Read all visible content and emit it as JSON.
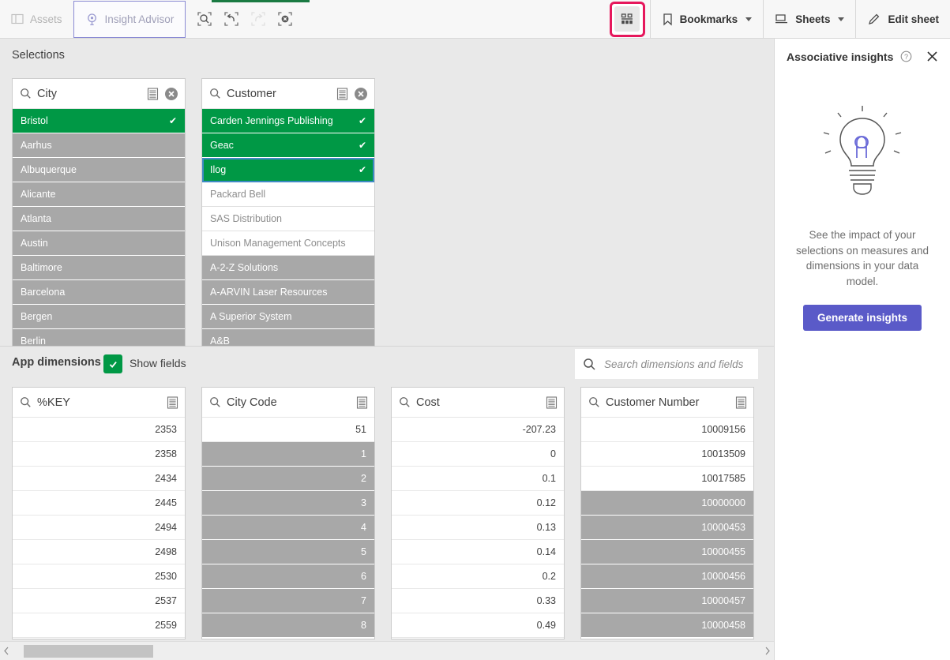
{
  "toolbar": {
    "assets_label": "Assets",
    "insight_advisor_label": "Insight Advisor",
    "selection_search_icon": "selection-search-icon",
    "step_back_icon": "step-back-icon",
    "step_forward_icon": "step-forward-icon",
    "clear_all_icon": "clear-all-selections-icon",
    "selections_tool_icon": "selections-tool-icon",
    "bookmarks_label": "Bookmarks",
    "sheets_label": "Sheets",
    "edit_sheet_label": "Edit sheet",
    "highlight_color": "#e6175c",
    "accent_green": "#1a7a42"
  },
  "selections": {
    "title": "Selections",
    "listboxes": [
      {
        "field": "City",
        "has_clear": true,
        "values": [
          {
            "text": "Bristol",
            "state": "selected",
            "check": true
          },
          {
            "text": "Aarhus",
            "state": "excluded"
          },
          {
            "text": "Albuquerque",
            "state": "excluded"
          },
          {
            "text": "Alicante",
            "state": "excluded"
          },
          {
            "text": "Atlanta",
            "state": "excluded"
          },
          {
            "text": "Austin",
            "state": "excluded"
          },
          {
            "text": "Baltimore",
            "state": "excluded"
          },
          {
            "text": "Barcelona",
            "state": "excluded"
          },
          {
            "text": "Bergen",
            "state": "excluded"
          },
          {
            "text": "Berlin",
            "state": "excluded"
          }
        ]
      },
      {
        "field": "Customer",
        "has_clear": true,
        "values": [
          {
            "text": "Carden Jennings Publishing",
            "state": "selected",
            "check": true
          },
          {
            "text": "Geac",
            "state": "selected",
            "check": true
          },
          {
            "text": "Ilog",
            "state": "selected",
            "check": true,
            "focus": true
          },
          {
            "text": "Packard Bell",
            "state": "alt"
          },
          {
            "text": "SAS Distribution",
            "state": "alt"
          },
          {
            "text": "Unison Management Concepts",
            "state": "alt"
          },
          {
            "text": "A-2-Z Solutions",
            "state": "excluded"
          },
          {
            "text": "A-ARVIN Laser Resources",
            "state": "excluded"
          },
          {
            "text": "A Superior System",
            "state": "excluded"
          },
          {
            "text": "A&B",
            "state": "excluded"
          }
        ]
      }
    ]
  },
  "app_dimensions": {
    "title": "App dimensions",
    "show_fields_label": "Show fields",
    "show_fields_checked": true,
    "search_placeholder": "Search dimensions and fields",
    "search_value": "",
    "fields": [
      {
        "field": "%KEY",
        "values": [
          {
            "text": "2353",
            "state": "avail"
          },
          {
            "text": "2358",
            "state": "avail"
          },
          {
            "text": "2434",
            "state": "avail"
          },
          {
            "text": "2445",
            "state": "avail"
          },
          {
            "text": "2494",
            "state": "avail"
          },
          {
            "text": "2498",
            "state": "avail"
          },
          {
            "text": "2530",
            "state": "avail"
          },
          {
            "text": "2537",
            "state": "avail"
          },
          {
            "text": "2559",
            "state": "avail"
          }
        ]
      },
      {
        "field": "City Code",
        "values": [
          {
            "text": "51",
            "state": "avail"
          },
          {
            "text": "1",
            "state": "excluded"
          },
          {
            "text": "2",
            "state": "excluded"
          },
          {
            "text": "3",
            "state": "excluded"
          },
          {
            "text": "4",
            "state": "excluded"
          },
          {
            "text": "5",
            "state": "excluded"
          },
          {
            "text": "6",
            "state": "excluded"
          },
          {
            "text": "7",
            "state": "excluded"
          },
          {
            "text": "8",
            "state": "excluded"
          }
        ]
      },
      {
        "field": "Cost",
        "values": [
          {
            "text": "-207.23",
            "state": "avail"
          },
          {
            "text": "0",
            "state": "avail"
          },
          {
            "text": "0.1",
            "state": "avail"
          },
          {
            "text": "0.12",
            "state": "avail"
          },
          {
            "text": "0.13",
            "state": "avail"
          },
          {
            "text": "0.14",
            "state": "avail"
          },
          {
            "text": "0.2",
            "state": "avail"
          },
          {
            "text": "0.33",
            "state": "avail"
          },
          {
            "text": "0.49",
            "state": "avail"
          }
        ]
      },
      {
        "field": "Customer Number",
        "values": [
          {
            "text": "10009156",
            "state": "avail"
          },
          {
            "text": "10013509",
            "state": "avail"
          },
          {
            "text": "10017585",
            "state": "avail"
          },
          {
            "text": "10000000",
            "state": "excluded"
          },
          {
            "text": "10000453",
            "state": "excluded"
          },
          {
            "text": "10000455",
            "state": "excluded"
          },
          {
            "text": "10000456",
            "state": "excluded"
          },
          {
            "text": "10000457",
            "state": "excluded"
          },
          {
            "text": "10000458",
            "state": "excluded"
          }
        ]
      }
    ]
  },
  "associative_insights": {
    "title": "Associative insights",
    "help_icon": "help-circle-icon",
    "close_icon": "close-icon",
    "illustration_icon": "lightbulb-icon",
    "description": "See the impact of your selections on measures and dimensions in your data model.",
    "button_label": "Generate insights",
    "button_color": "#5a5ac8"
  },
  "scrollbar": {
    "left_arrow_icon": "scroll-left-icon",
    "right_arrow_icon": "scroll-right-icon"
  }
}
